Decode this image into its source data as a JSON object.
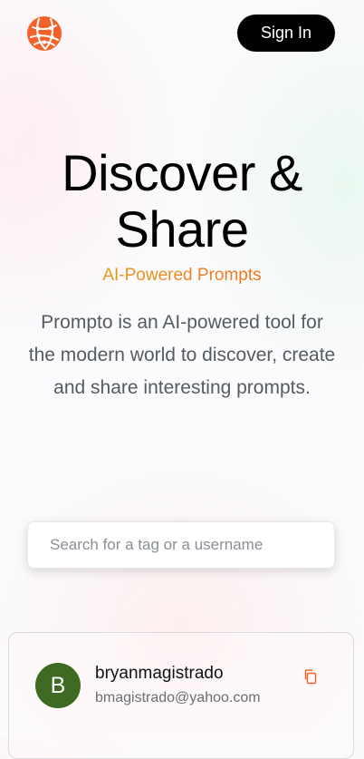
{
  "nav": {
    "logo_icon": "globe-network-icon",
    "signin_label": "Sign In"
  },
  "hero": {
    "title_line1": "Discover &",
    "title_line2": "Share",
    "subtitle": "AI-Powered Prompts",
    "description": "Prompto is an AI-powered tool for the modern world to discover, create and share interesting prompts."
  },
  "search": {
    "placeholder": "Search for a tag or a username",
    "value": ""
  },
  "feed": {
    "cards": [
      {
        "avatar_letter": "B",
        "username": "bryanmagistrado",
        "email": "bmagistrado@yahoo.com",
        "copy_icon": "copy-icon"
      }
    ]
  },
  "colors": {
    "brand_orange": "#f4622a",
    "subtitle_gradient_start": "#e49a14",
    "subtitle_gradient_end": "#f3711f",
    "avatar_green": "#3f6a22",
    "button_black": "#000000"
  }
}
